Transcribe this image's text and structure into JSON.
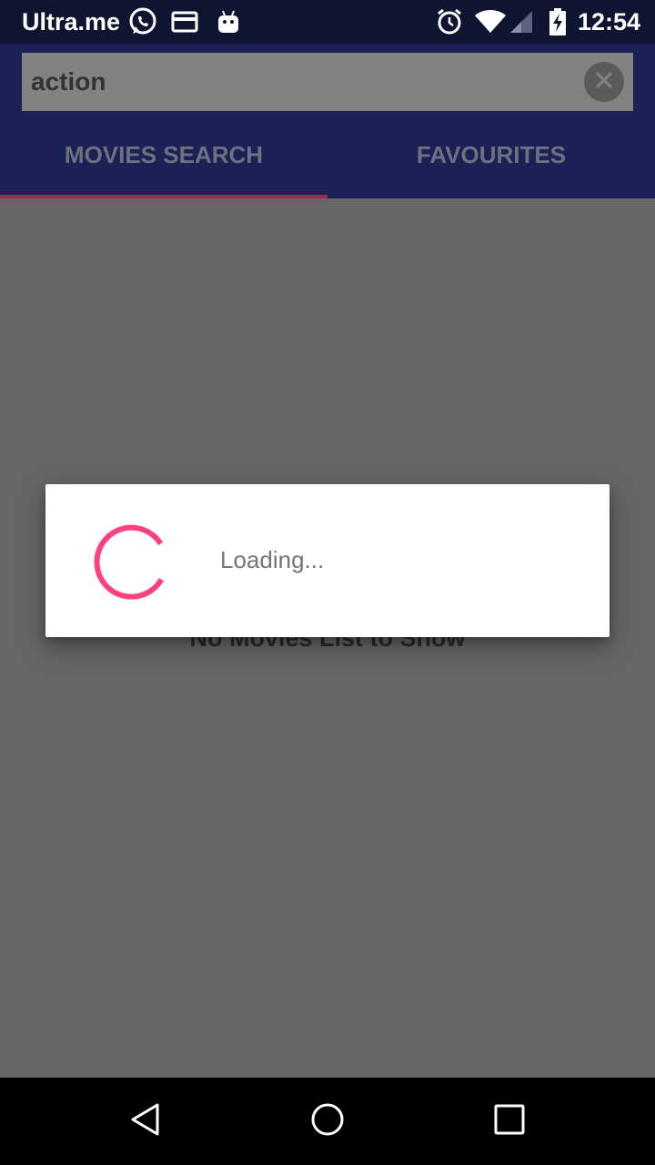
{
  "status_bar": {
    "carrier": "Ultra.me",
    "time": "12:54",
    "icons_left": [
      "whatsapp-icon",
      "card-icon",
      "android-icon"
    ],
    "icons_right": [
      "alarm-icon",
      "wifi-icon",
      "signal-icon",
      "battery-charging-icon"
    ]
  },
  "search": {
    "value": "action",
    "clear_icon": "close-circle-icon"
  },
  "tabs": [
    {
      "label": "MOVIES SEARCH",
      "selected": true
    },
    {
      "label": "FAVOURITES",
      "selected": false
    }
  ],
  "content": {
    "empty_message": "No Movies List to Show"
  },
  "dialog": {
    "loading_text": "Loading..."
  },
  "nav_bar": {
    "icons": [
      "back-icon",
      "home-icon",
      "recents-icon"
    ]
  },
  "colors": {
    "status_bar": "#0f1431",
    "app_bar": "#1b2154",
    "accent": "#ff4081",
    "scrim": "#666666"
  }
}
